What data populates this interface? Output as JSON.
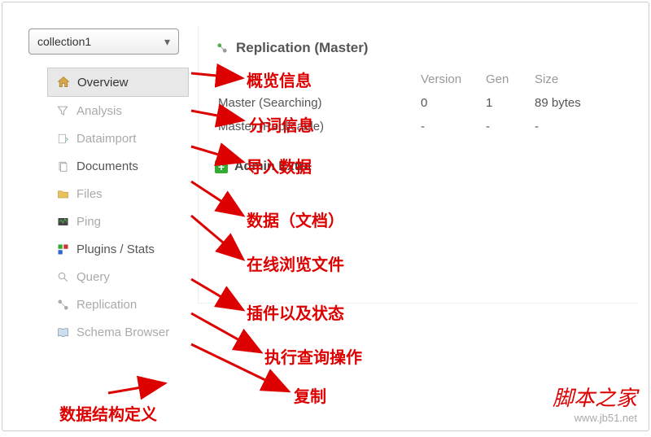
{
  "dropdown": {
    "label": "collection1"
  },
  "sidebar": {
    "items": [
      {
        "label": "Overview",
        "icon": "home",
        "active": true
      },
      {
        "label": "Analysis",
        "icon": "funnel"
      },
      {
        "label": "Dataimport",
        "icon": "import"
      },
      {
        "label": "Documents",
        "icon": "docs",
        "dark": true
      },
      {
        "label": "Files",
        "icon": "folder"
      },
      {
        "label": "Ping",
        "icon": "ping"
      },
      {
        "label": "Plugins / Stats",
        "icon": "plugins",
        "dark": true
      },
      {
        "label": "Query",
        "icon": "search"
      },
      {
        "label": "Replication",
        "icon": "replication"
      },
      {
        "label": "Schema Browser",
        "icon": "book"
      }
    ]
  },
  "main": {
    "replication": {
      "title": "Replication (Master)",
      "headers": {
        "name": "",
        "version": "Version",
        "gen": "Gen",
        "size": "Size"
      },
      "rows": [
        {
          "name": "Master (Searching)",
          "version": "0",
          "gen": "1",
          "size": "89 bytes"
        },
        {
          "name": "Master (Replicable)",
          "version": "-",
          "gen": "-",
          "size": "-"
        }
      ]
    },
    "admin": {
      "title": "Admin Extra"
    }
  },
  "annotations": {
    "overview": "概览信息",
    "analysis": "分词信息",
    "dataimport": "导入数据",
    "documents": "数据（文档）",
    "files": "在线浏览文件",
    "plugins": "插件以及状态",
    "query": "执行查询操作",
    "replication": "复制",
    "schema": "数据结构定义"
  },
  "watermark": {
    "title": "脚本之家",
    "url": "www.jb51.net"
  }
}
